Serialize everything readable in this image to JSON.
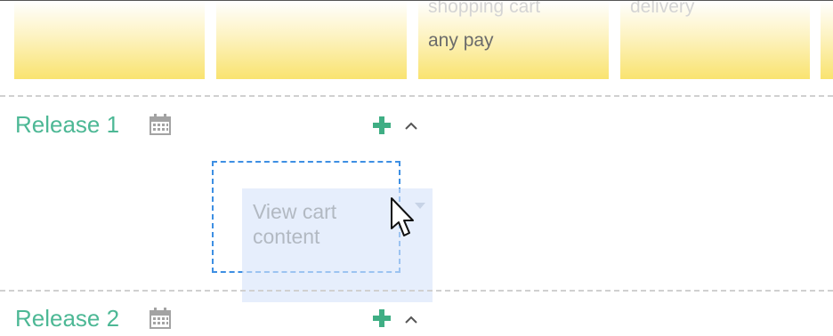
{
  "cards": [
    {
      "line1": "",
      "line2": ""
    },
    {
      "line1": "",
      "line2": ""
    },
    {
      "line1": "shopping cart",
      "line2": "any pay"
    },
    {
      "line1": "delivery",
      "line2": ""
    },
    {
      "line1": "",
      "line2": ""
    }
  ],
  "releases": [
    {
      "label": "Release 1"
    },
    {
      "label": "Release 2"
    }
  ],
  "drag_card": {
    "line1": "View cart",
    "line2": "content"
  },
  "icons": {
    "calendar": "calendar-icon",
    "add": "plus-icon",
    "collapse": "chevron-up-icon",
    "dropdown": "caret-down-icon",
    "cursor": "mouse-pointer-icon"
  },
  "colors": {
    "release_label": "#4db895",
    "card_gradient_bottom": "#f9e36f",
    "drop_outline": "#3d8fe3",
    "drag_card_bg": "#d6e4fa"
  }
}
